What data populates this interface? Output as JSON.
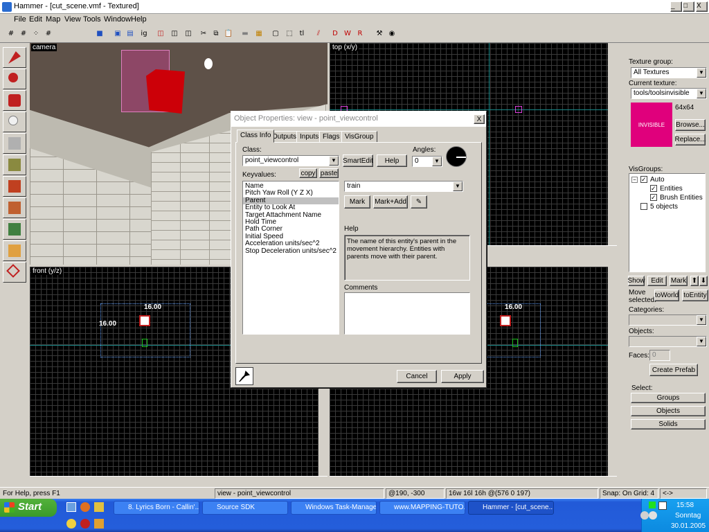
{
  "window": {
    "title": "Hammer - [cut_scene.vmf - Textured]",
    "minimize": "_",
    "maximize": "□",
    "close": "X"
  },
  "menu": [
    "File",
    "Edit",
    "Map",
    "View",
    "Tools",
    "Window",
    "Help"
  ],
  "viewports": {
    "camera_label": "camera",
    "top_label": "top (x/y)",
    "front_label": "front (y/z)",
    "dim_top": "16.00",
    "dim_side": "16.00",
    "dim_right_top": "16.00"
  },
  "dialog": {
    "title": "Object Properties: view - point_viewcontrol",
    "close": "X",
    "tabs": [
      "Class Info",
      "Outputs",
      "Inputs",
      "Flags",
      "VisGroup"
    ],
    "class_label": "Class:",
    "class_value": "point_viewcontrol",
    "smartedit": "SmartEdit",
    "help": "Help",
    "angles_label": "Angles:",
    "angles_value": "0",
    "keyvalues_label": "Keyvalues:",
    "copy": "copy",
    "paste": "paste",
    "keyvalues": [
      "Name",
      "Pitch Yaw Roll (Y Z X)",
      "Parent",
      "Entity to Look At",
      "Target Attachment Name",
      "Hold Time",
      "Path Corner",
      "Initial Speed",
      "Acceleration units/sec^2",
      "Stop Deceleration units/sec^2"
    ],
    "selected_index": 2,
    "value_field": "train",
    "mark": "Mark",
    "mark_add": "Mark+Add",
    "help_label": "Help",
    "help_text": "The name of this entity's parent in the movement hierarchy. Entities with parents move with their parent.",
    "comments_label": "Comments",
    "cancel": "Cancel",
    "apply": "Apply"
  },
  "rightpanel": {
    "texture_group_label": "Texture group:",
    "texture_group_value": "All Textures",
    "current_texture_label": "Current texture:",
    "current_texture_value": "tools/toolsinvisible",
    "texture_size": "64x64",
    "texture_swatch_text": "INVISIBLE",
    "browse": "Browse...",
    "replace": "Replace...",
    "visgroups_label": "VisGroups:",
    "visgroups": [
      "Auto",
      "Entities",
      "Brush Entities",
      "5 objects"
    ],
    "show": "Show",
    "edit": "Edit",
    "mark": "Mark",
    "move_selected": "Move selected:",
    "toworld": "toWorld",
    "toentity": "toEntity",
    "categories_label": "Categories:",
    "objects_label": "Objects:",
    "faces_label": "Faces:",
    "faces_value": "0",
    "create_prefab": "Create Prefab",
    "select_label": "Select:",
    "groups": "Groups",
    "objects": "Objects",
    "solids": "Solids"
  },
  "status": {
    "help": "For Help, press F1",
    "selection": "view - point_viewcontrol",
    "coords": "@190, -300",
    "size": "16w 16l 16h @(576 0 197)",
    "snap": "Snap: On Grid: 4",
    "arrows": "<->"
  },
  "taskbar": {
    "start": "Start",
    "tasks": [
      "8. Lyrics Born - Callin'...",
      "Source SDK",
      "Windows Task-Manager",
      "www.MAPPING-TUTO...",
      "Hammer - [cut_scene..."
    ],
    "time": "15:58",
    "day": "Sonntag",
    "date": "30.01.2005"
  }
}
